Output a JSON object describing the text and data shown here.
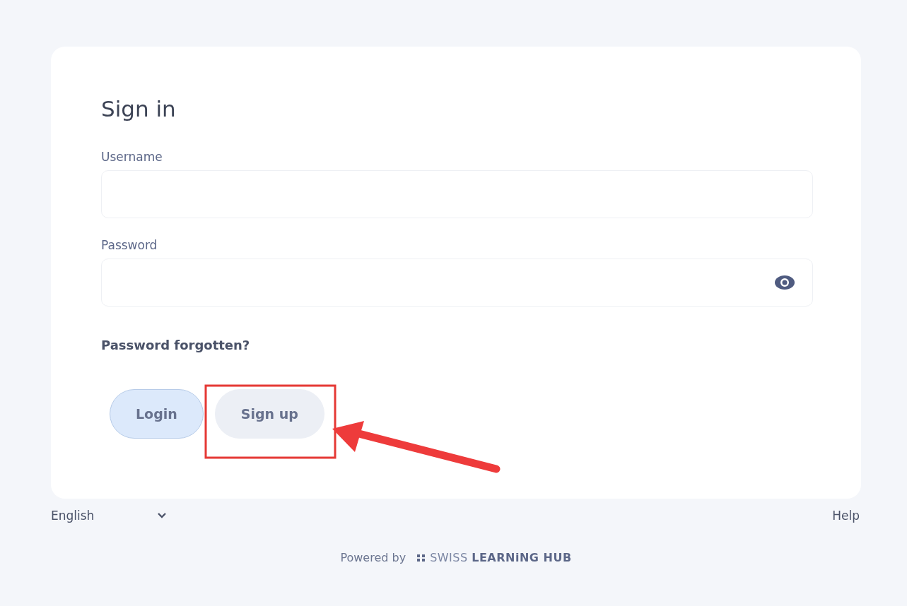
{
  "sign_in": {
    "title": "Sign in",
    "fields": [
      {
        "label": "Username",
        "kind": "text"
      },
      {
        "label": "Password",
        "kind": "password"
      }
    ],
    "forgot_link": "Password forgotten?",
    "buttons": [
      {
        "label": "Login",
        "kind": "primary"
      },
      {
        "label": "Sign up",
        "kind": "secondary"
      }
    ]
  },
  "footer": {
    "language": "English",
    "help": "Help",
    "powered_by": "Powered by",
    "brand": "SWISS **LEARNiNG HUB**"
  }
}
